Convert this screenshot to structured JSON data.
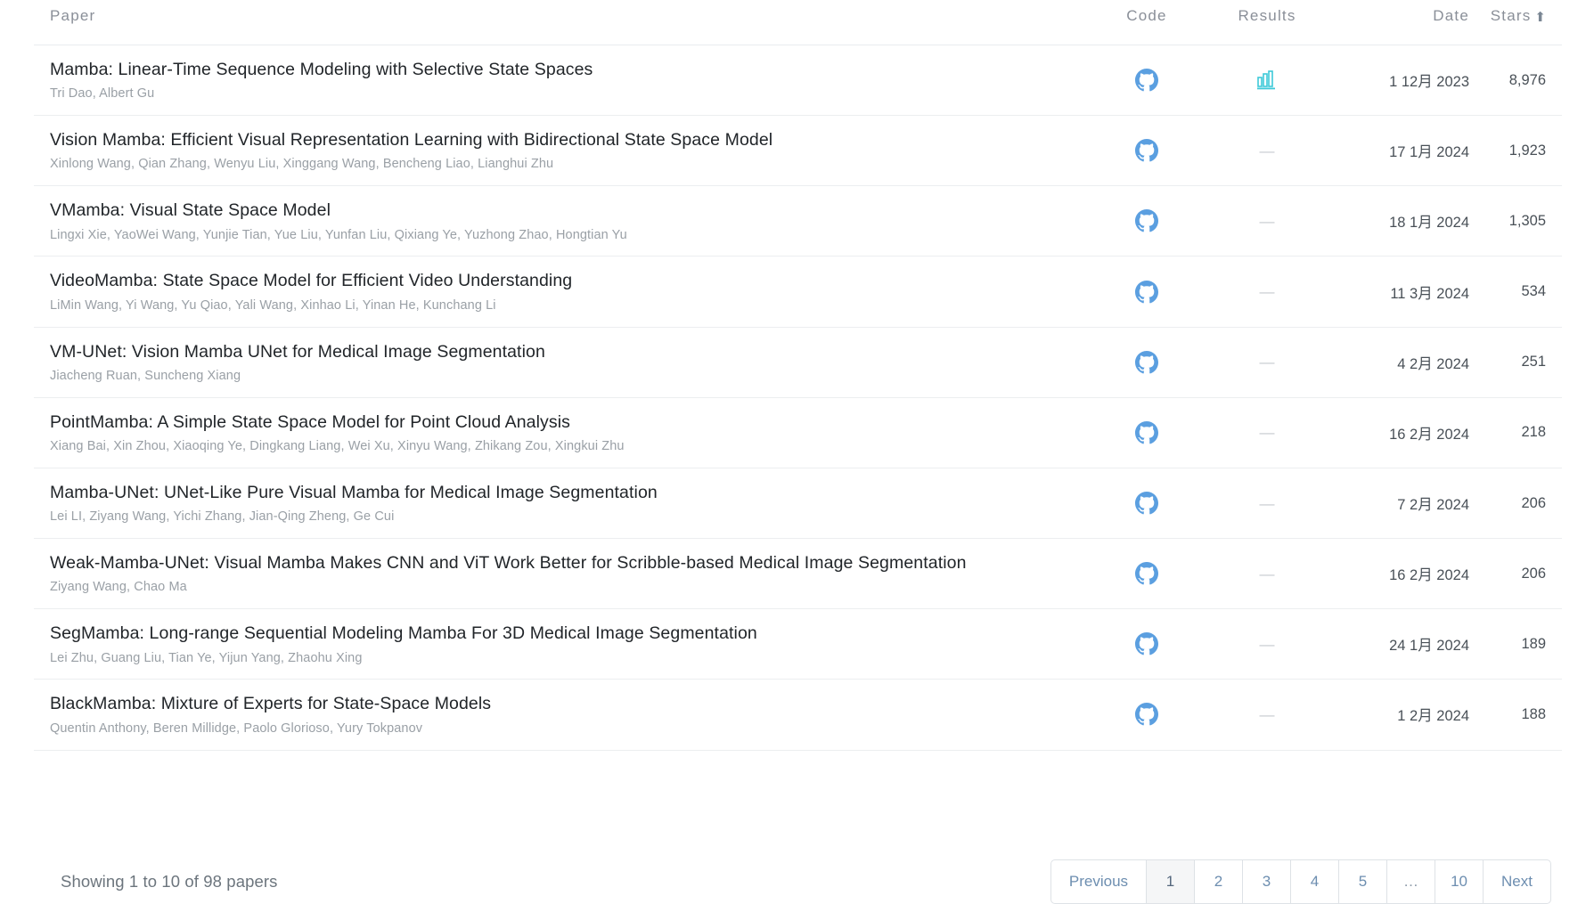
{
  "table": {
    "headers": {
      "paper": "Paper",
      "code": "Code",
      "results": "Results",
      "date": "Date",
      "stars": "Stars",
      "sort_arrow": "⬆"
    },
    "icons": {
      "code": "github-icon",
      "results_chart": "bar-chart-icon",
      "results_empty": "—"
    },
    "rows": [
      {
        "title": "Mamba: Linear-Time Sequence Modeling with Selective State Spaces",
        "authors": "Tri Dao, Albert Gu",
        "code": "github",
        "results": "chart",
        "date": "1 12月 2023",
        "stars": "8,976"
      },
      {
        "title": "Vision Mamba: Efficient Visual Representation Learning with Bidirectional State Space Model",
        "authors": "Xinlong Wang, Qian Zhang, Wenyu Liu, Xinggang Wang, Bencheng Liao, Lianghui Zhu",
        "code": "github",
        "results": "none",
        "date": "17 1月 2024",
        "stars": "1,923"
      },
      {
        "title": "VMamba: Visual State Space Model",
        "authors": "Lingxi Xie, YaoWei Wang, Yunjie Tian, Yue Liu, Yunfan Liu, Qixiang Ye, Yuzhong Zhao, Hongtian Yu",
        "code": "github",
        "results": "none",
        "date": "18 1月 2024",
        "stars": "1,305"
      },
      {
        "title": "VideoMamba: State Space Model for Efficient Video Understanding",
        "authors": "LiMin Wang, Yi Wang, Yu Qiao, Yali Wang, Xinhao Li, Yinan He, Kunchang Li",
        "code": "github",
        "results": "none",
        "date": "11 3月 2024",
        "stars": "534"
      },
      {
        "title": "VM-UNet: Vision Mamba UNet for Medical Image Segmentation",
        "authors": "Jiacheng Ruan, Suncheng Xiang",
        "code": "github",
        "results": "none",
        "date": "4 2月 2024",
        "stars": "251"
      },
      {
        "title": "PointMamba: A Simple State Space Model for Point Cloud Analysis",
        "authors": "Xiang Bai, Xin Zhou, Xiaoqing Ye, Dingkang Liang, Wei Xu, Xinyu Wang, Zhikang Zou, Xingkui Zhu",
        "code": "github",
        "results": "none",
        "date": "16 2月 2024",
        "stars": "218"
      },
      {
        "title": "Mamba-UNet: UNet-Like Pure Visual Mamba for Medical Image Segmentation",
        "authors": "Lei LI, Ziyang Wang, Yichi Zhang, Jian-Qing Zheng, Ge Cui",
        "code": "github",
        "results": "none",
        "date": "7 2月 2024",
        "stars": "206"
      },
      {
        "title": "Weak-Mamba-UNet: Visual Mamba Makes CNN and ViT Work Better for Scribble-based Medical Image Segmentation",
        "authors": "Ziyang Wang, Chao Ma",
        "code": "github",
        "results": "none",
        "date": "16 2月 2024",
        "stars": "206"
      },
      {
        "title": "SegMamba: Long-range Sequential Modeling Mamba For 3D Medical Image Segmentation",
        "authors": "Lei Zhu, Guang Liu, Tian Ye, Yijun Yang, Zhaohu Xing",
        "code": "github",
        "results": "none",
        "date": "24 1月 2024",
        "stars": "189"
      },
      {
        "title": "BlackMamba: Mixture of Experts for State-Space Models",
        "authors": "Quentin Anthony, Beren Millidge, Paolo Glorioso, Yury Tokpanov",
        "code": "github",
        "results": "none",
        "date": "1 2月 2024",
        "stars": "188"
      }
    ]
  },
  "footer": {
    "showing": "Showing 1 to 10 of 98 papers",
    "pagination": {
      "previous": "Previous",
      "next": "Next",
      "pages": [
        "1",
        "2",
        "3",
        "4",
        "5",
        "…",
        "10"
      ],
      "active_page": "1"
    }
  },
  "colors": {
    "github_icon": "#5b9fe0",
    "results_icon": "#3dc9d8",
    "title_text": "#212529",
    "author_text": "#9aa0a6",
    "header_text": "#8a8f98",
    "row_border": "#eceef0",
    "pagination_link": "#6d8eb0",
    "pagination_active_bg": "#f5f6f7"
  }
}
